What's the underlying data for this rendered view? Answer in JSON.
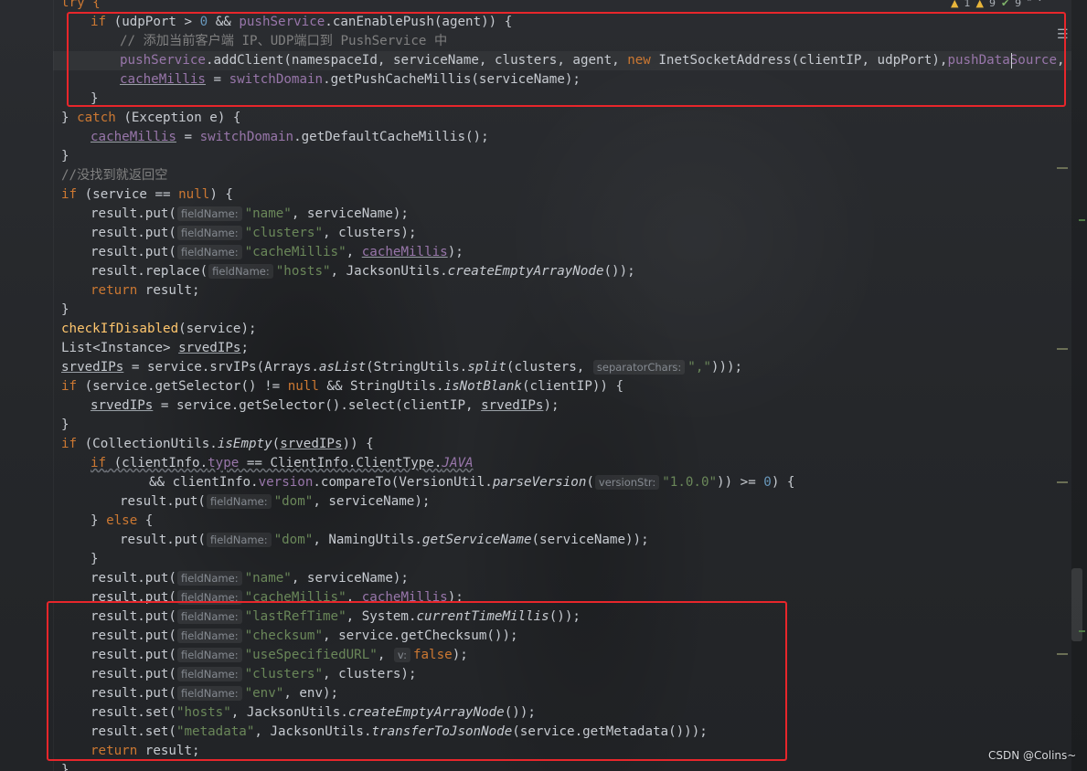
{
  "editor": {
    "status": {
      "warnings": "1",
      "weak_warnings": "9",
      "checks": "9"
    },
    "watermark": "CSDN @Colins~"
  },
  "code": {
    "l01_try": "try {",
    "l02_if": "if",
    "l02_open": " (",
    "l02_udpPort": "udpPort > ",
    "l02_zero": "0",
    "l02_and": " && ",
    "l02_pushService": "pushService",
    "l02_dot": ".",
    "l02_canEnablePush": "canEnablePush",
    "l02_args": "(agent)) {",
    "l03_comment": "// 添加当前客户端 IP、UDP端口到 PushService 中",
    "l04_pushService": "pushService",
    "l04_call": ".addClient(namespaceId, serviceName, clusters, agent, ",
    "l04_new": "new",
    "l04_inet": " InetSocketAddress(clientIP, udpPort),",
    "l04_pushDataSource": "pushDataSource",
    "l04_rest": ", tid, app",
    "l05_cacheMillis": "cacheMillis",
    "l05_eq": " = ",
    "l05_switchDomain": "switchDomain",
    "l05_call": ".getPushCacheMillis(serviceName);",
    "l06_brace": "}",
    "l07_close": "} ",
    "l07_catch": "catch",
    "l07_rest": " (Exception e) {",
    "l08_cacheMillis": "cacheMillis",
    "l08_eq": " = ",
    "l08_switchDomain": "switchDomain",
    "l08_call": ".getDefaultCacheMillis();",
    "l09_brace": "}",
    "l10_comment": "//没找到就返回空",
    "l11_if": "if",
    "l11_a": " (service == ",
    "l11_null": "null",
    "l11_b": ") {",
    "rp": "result.put(",
    "hint_fieldName": "fieldName:",
    "s_name": "\"name\"",
    "s_clusters": "\"clusters\"",
    "s_cacheMillis": "\"cacheMillis\"",
    "s_hosts": "\"hosts\"",
    "s_dom": "\"dom\"",
    "s_lastRefTime": "\"lastRefTime\"",
    "s_checksum": "\"checksum\"",
    "s_useSpecifiedURL": "\"useSpecifiedURL\"",
    "s_env": "\"env\"",
    "s_metadata": "\"metadata\"",
    "s_comma": "\",\"",
    "s_version": "\"1.0.0\"",
    "a_serviceName": ", serviceName);",
    "a_clusters": ", clusters);",
    "a_comma": ", ",
    "a_close": ");",
    "cacheMillis": "cacheMillis",
    "l15_replace": "result.replace(",
    "l15_mid": ", JacksonUtils.",
    "createEmptyArrayNode": "createEmptyArrayNode",
    "l15_end": "());",
    "return": "return",
    "l16_rest": " result;",
    "l17_brace": "}",
    "l18_checkIfDisabled": "checkIfDisabled",
    "l18_rest": "(service);",
    "l19_list": "List<Instance> ",
    "srvedIPs": "srvedIPs",
    "l19_end": ";",
    "l20_mid": " = service.srvIPs(Arrays.",
    "asList": "asList",
    "l20_b": "(StringUtils.",
    "split": "split",
    "l20_c": "(clusters, ",
    "hint_separatorChars": "separatorChars:",
    "l20_end": ")));",
    "l21_a": " (service.getSelector() != ",
    "l21_b": " && StringUtils.",
    "isNotBlank": "isNotBlank",
    "l21_c": "(clientIP)) {",
    "l22_a": " = service.getSelector().select(clientIP, ",
    "l22_end": ");",
    "l23_brace": "}",
    "l24_a": " (CollectionUtils.",
    "isEmpty": "isEmpty",
    "l24_b": "(",
    "l24_c": ")) {",
    "l25_a": " (clientInfo.",
    "type": "type",
    "l25_b": " == ClientInfo.ClientType.",
    "JAVA": "JAVA",
    "l26_a": "&& clientInfo.",
    "version": "version",
    "l26_b": ".compareTo(VersionUtil.",
    "parseVersion": "parseVersion",
    "l26_c": "(",
    "hint_versionStr": "versionStr:",
    "l26_d": ")) >= ",
    "l26_zero": "0",
    "l26_e": ") {",
    "l28_close": "} ",
    "else": "else",
    "l28_open": " {",
    "l29_mid": ", NamingUtils.",
    "getServiceName": "getServiceName",
    "l29_end": "(serviceName));",
    "l30_brace": "}",
    "l33_mid": ", System.",
    "currentTimeMillis": "currentTimeMillis",
    "l33_end": "());",
    "l34_mid": ", service.getChecksum());",
    "hint_v": "v:",
    "false": "false",
    "l37_mid": ", env);",
    "rs": "result.set(",
    "l38_mid": ", JacksonUtils.",
    "l39_mid": ", JacksonUtils.",
    "transferToJsonNode": "transferToJsonNode",
    "l39_end": "(service.getMetadata()));",
    "l40_rest": " result;",
    "l41_brace": "}"
  }
}
